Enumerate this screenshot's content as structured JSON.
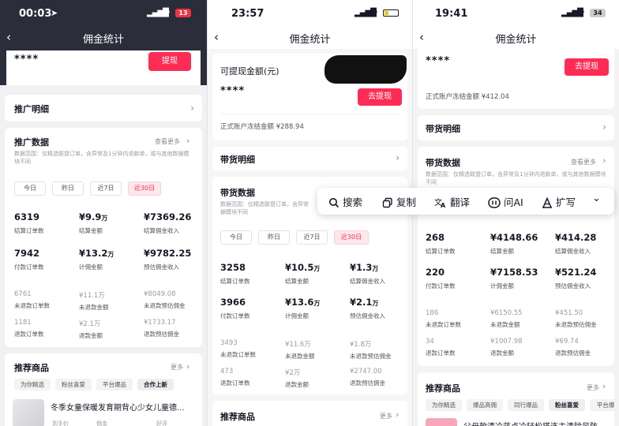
{
  "colors": {
    "accent": "#fe2c55",
    "accent_bg": "#fde8ec",
    "p1_header": "#2b2d3a"
  },
  "panel1": {
    "status": {
      "time": "00:03",
      "battery": "13"
    },
    "nav": {
      "title": "佣金统计"
    },
    "masked_amount": "****",
    "withdraw_button": "提现",
    "promo_detail": "推广明细",
    "data_section": {
      "title": "推广数据",
      "more": "查看更多",
      "scope_note": "数据范围：仅精选联盟订单，含异常及1分钟内退款单，或与其他数据模块不同",
      "ranges": [
        "今日",
        "昨日",
        "近7日",
        "近30日"
      ],
      "stats": [
        {
          "value": "6319",
          "label": "结算订单数"
        },
        {
          "value": "¥9.9",
          "unit": "万",
          "label": "结算金额"
        },
        {
          "value": "¥7369.26",
          "label": "结算佣金收入"
        },
        {
          "value": "7942",
          "label": "付款订单数"
        },
        {
          "value": "¥13.2",
          "unit": "万",
          "label": "计佣金额"
        },
        {
          "value": "¥9782.25",
          "label": "预估佣金收入"
        }
      ],
      "sub_stats": [
        {
          "value": "6761",
          "label": "未退款订单数"
        },
        {
          "value": "¥11.1万",
          "label": "未退款金额"
        },
        {
          "value": "¥8049.08",
          "label": "未退款预估佣金"
        },
        {
          "value": "1181",
          "label": "退款订单数"
        },
        {
          "value": "¥2.1万",
          "label": "退款金额"
        },
        {
          "value": "¥1733.17",
          "label": "退款预估佣金"
        }
      ]
    },
    "products": {
      "title": "推荐商品",
      "more": "更多",
      "tabs": [
        "为你精选",
        "粉丝喜爱",
        "平台爆品",
        "合作上新"
      ],
      "item_title": "冬季女童保暖发育期背心少女儿童德...",
      "item_labels": [
        "到手价",
        "佣金",
        "好评"
      ]
    }
  },
  "panel2": {
    "status": {
      "time": "23:57"
    },
    "nav": {
      "title": "佣金统计"
    },
    "withdrawable_label": "可提现金额(元)",
    "masked_amount": "****",
    "withdraw_button": "去提现",
    "frozen": "正式账户冻结金额 ¥288.94",
    "goods_detail": "带货明细",
    "data_section": {
      "title": "带货数据",
      "scope_note": "数据范围：仅精选联盟订单，含异常",
      "scope_note2": "据模块不同",
      "ranges": [
        "今日",
        "昨日",
        "近7日",
        "近30日"
      ],
      "stats": [
        {
          "value": "3258",
          "label": "结算订单数"
        },
        {
          "value": "¥10.5",
          "unit": "万",
          "label": "结算金额"
        },
        {
          "value": "¥1.3",
          "unit": "万",
          "label": "结算佣金收入"
        },
        {
          "value": "3966",
          "label": "付款订单数"
        },
        {
          "value": "¥13.6",
          "unit": "万",
          "label": "计佣金额"
        },
        {
          "value": "¥2.1",
          "unit": "万",
          "label": "预估佣金收入"
        }
      ],
      "sub_stats": [
        {
          "value": "3493",
          "label": "未退款订单数"
        },
        {
          "value": "¥11.6万",
          "label": "未退款金额"
        },
        {
          "value": "¥1.8万",
          "label": "未退款预估佣金"
        },
        {
          "value": "473",
          "label": "退款订单数"
        },
        {
          "value": "¥2万",
          "label": "退款金额"
        },
        {
          "value": "¥2747.00",
          "label": "退款预估佣金"
        }
      ]
    },
    "products": {
      "title": "推荐商品",
      "more": "更多"
    }
  },
  "panel3": {
    "status": {
      "time": "19:41",
      "battery": "34"
    },
    "nav": {
      "title": "佣金统计"
    },
    "masked_amount": "****",
    "withdraw_button": "去提现",
    "frozen": "正式账户冻结金额 ¥412.04",
    "goods_detail": "带货明细",
    "data_section": {
      "title": "带货数据",
      "more": "查看更多",
      "scope_note": "数据范围：仅精选联盟订单，含异常及1分钟内退款单，或与其他数据模块不同",
      "stats": [
        {
          "value": "268",
          "label": "结算订单数"
        },
        {
          "value": "¥4148.66",
          "label": "结算金额"
        },
        {
          "value": "¥414.28",
          "label": "结算佣金收入"
        },
        {
          "value": "220",
          "label": "付款订单数"
        },
        {
          "value": "¥7158.53",
          "label": "计佣金额"
        },
        {
          "value": "¥521.24",
          "label": "预估佣金收入"
        }
      ],
      "sub_stats": [
        {
          "value": "186",
          "label": "未退款订单数"
        },
        {
          "value": "¥6150.55",
          "label": "未退款金额"
        },
        {
          "value": "¥451.50",
          "label": "未退款预估佣金"
        },
        {
          "value": "34",
          "label": "退款订单数"
        },
        {
          "value": "¥1007.98",
          "label": "退款金额"
        },
        {
          "value": "¥69.74",
          "label": "退款预估佣金"
        }
      ]
    },
    "products": {
      "title": "推荐商品",
      "more": "更多",
      "tabs": [
        "为你精选",
        "爆品高佣",
        "同行爆品",
        "粉丝喜爱",
        "平台爆"
      ],
      "item_title": "父母款清冷蓝点冷轻松搭连主清除风防"
    }
  },
  "context_menu": {
    "items": [
      {
        "label": "搜索",
        "icon": "search-icon"
      },
      {
        "label": "复制",
        "icon": "copy-icon"
      },
      {
        "label": "翻译",
        "icon": "translate-icon"
      },
      {
        "label": "问AI",
        "icon": "ai-icon"
      },
      {
        "label": "扩写",
        "icon": "expand-write-icon"
      }
    ]
  }
}
